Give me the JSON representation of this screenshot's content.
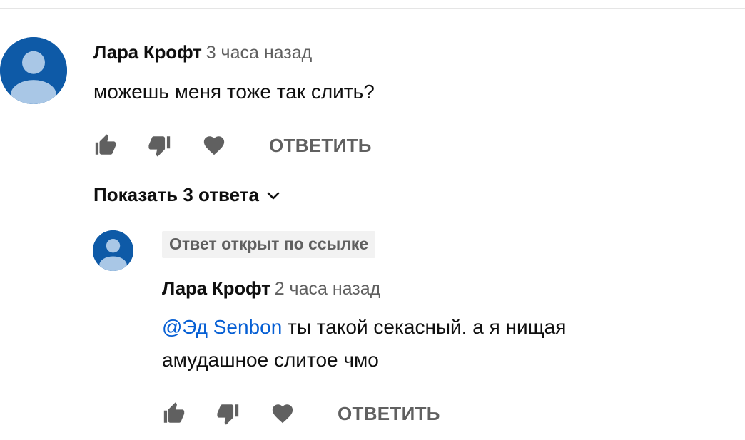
{
  "comment": {
    "author": "Лара Крофт",
    "time": "3 часа назад",
    "text": "можешь меня тоже так слить?",
    "reply_label": "ОТВЕТИТЬ"
  },
  "show_replies_label": "Показать 3 ответа",
  "reply": {
    "badge": "Ответ открыт по ссылке",
    "author": "Лара Крофт",
    "time": "2 часа назад",
    "mention": "@Эд Senbon",
    "text": " ты такой секасный.  а я нищая амудашное слитое чмо",
    "reply_label": "ОТВЕТИТЬ"
  },
  "colors": {
    "avatar_bg": "#0e5aa7",
    "avatar_fg": "#a9c7e6",
    "mention": "#065fd4",
    "secondary_text": "#606060"
  },
  "icons": [
    "like-icon",
    "dislike-icon",
    "heart-icon",
    "chevron-down-icon"
  ]
}
